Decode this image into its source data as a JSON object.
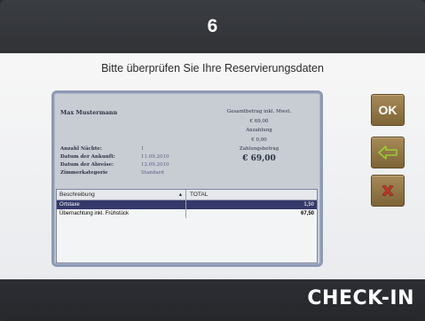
{
  "header": {
    "step": "6"
  },
  "screen": {
    "title": "Bitte überprüfen Sie Ihre Reservierungsdaten"
  },
  "reservation": {
    "guest_name": "Max Mustermann",
    "total_label": "Gesamtbetrag inkl. Mwst.",
    "total_value": "€ 69,00",
    "deposit_label": "Anzahlung",
    "deposit_value": "€ 0,00",
    "payment_label": "Zahlungsbetrag",
    "payment_value": "€ 69,00",
    "details": [
      {
        "label": "Anzahl Nächte:",
        "value": "1"
      },
      {
        "label": "Datum der Ankunft:",
        "value": "11.09.2010"
      },
      {
        "label": "Datum der Abreise:",
        "value": "12.09.2010"
      },
      {
        "label": "Zimmerkategorie",
        "value": "Standard"
      }
    ]
  },
  "table": {
    "columns": [
      "Beschreibung",
      "TOTAL"
    ],
    "rows": [
      {
        "description": "Ortstaxe",
        "total": "1,50",
        "selected": true
      },
      {
        "description": "Übernachtung inkl. Frühstück",
        "total": "67,50",
        "selected": false
      }
    ]
  },
  "buttons": {
    "ok_label": "OK",
    "back_icon": "arrow-left-icon",
    "cancel_icon": "close-x-icon"
  },
  "footer": {
    "label": "CHECK-IN"
  },
  "colors": {
    "button_brown": "#8f7546",
    "back_arrow": "#9acd32",
    "cancel_x": "#c0392b",
    "selected_row": "#34386a"
  }
}
